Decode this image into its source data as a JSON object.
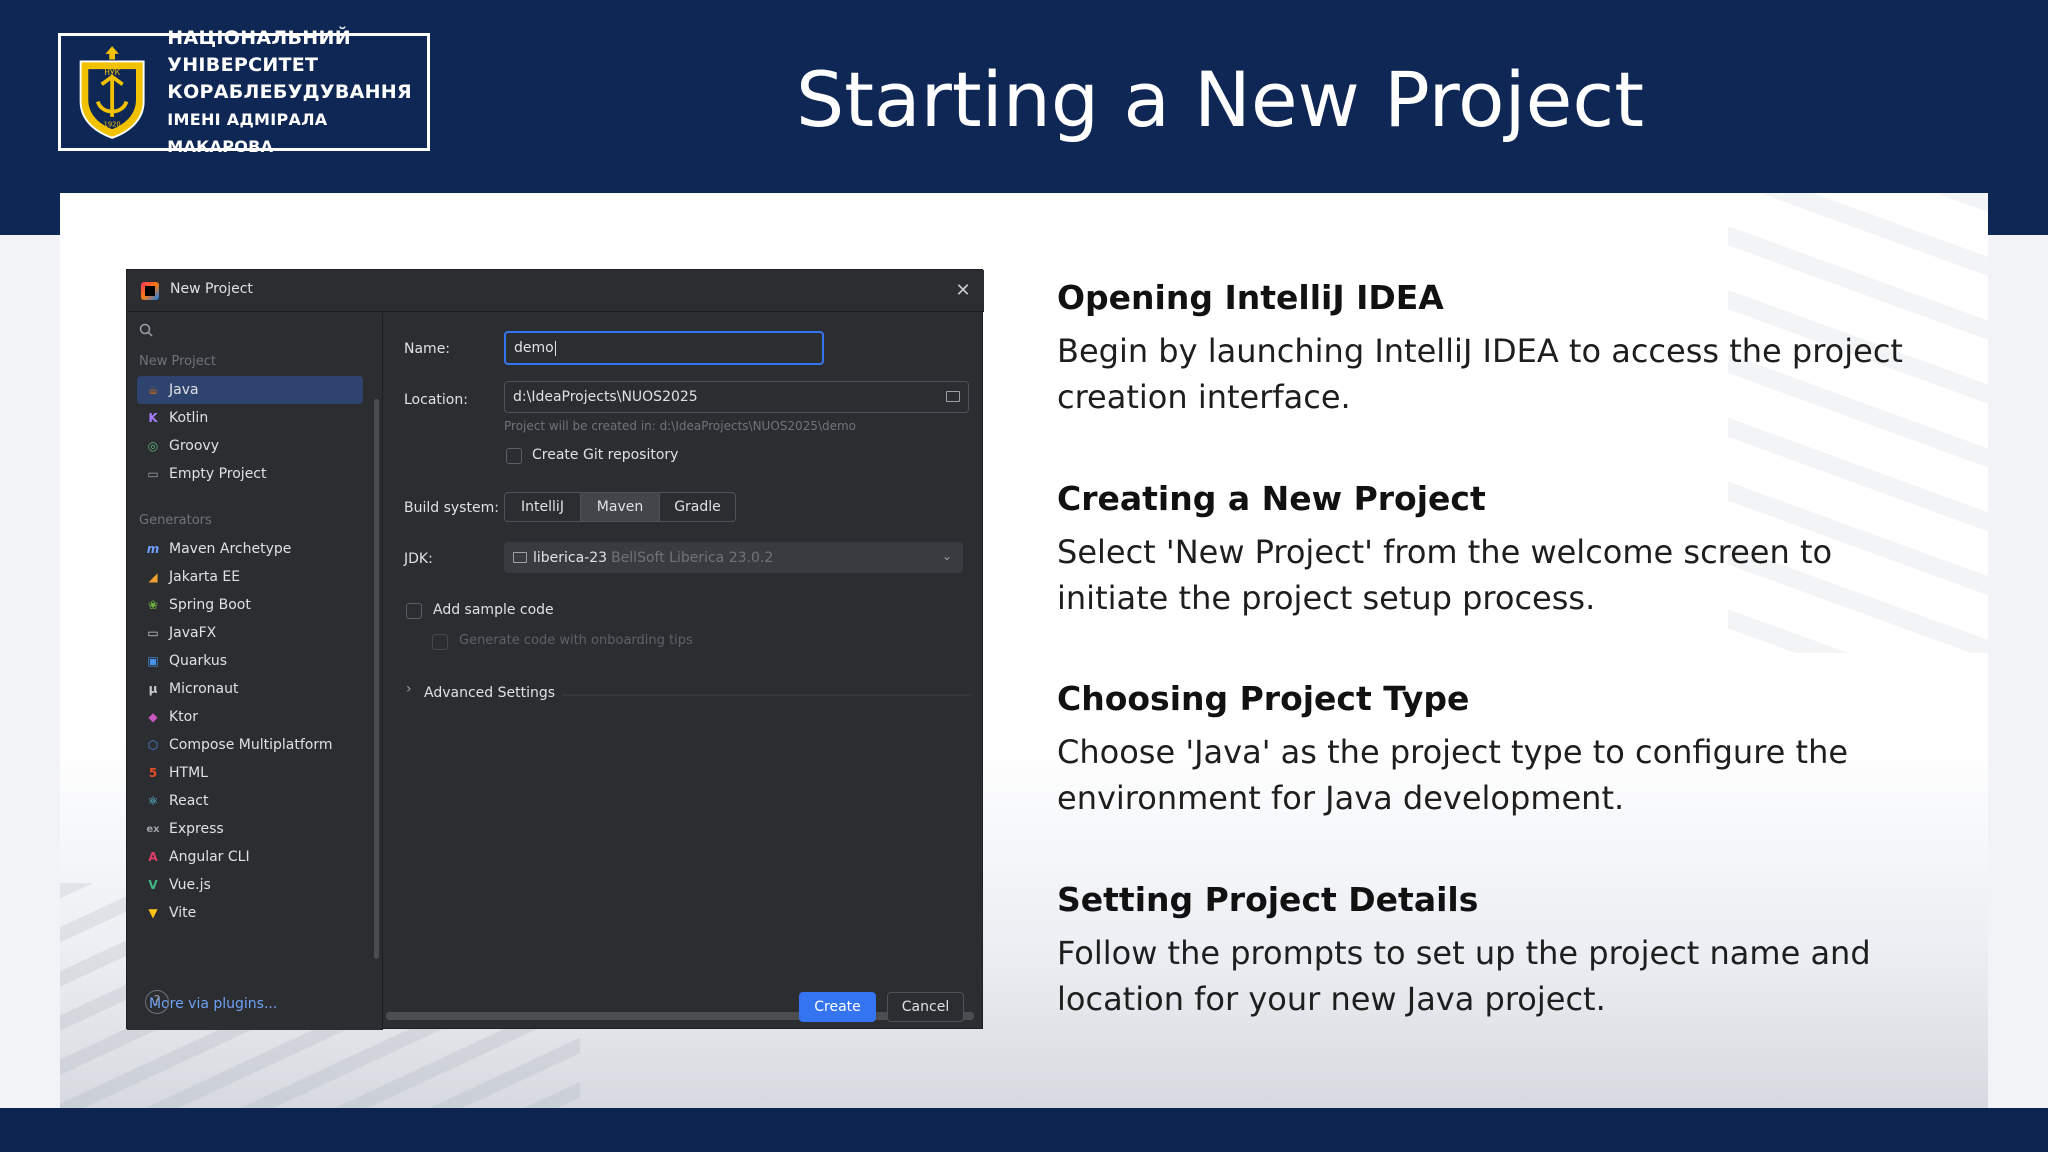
{
  "slide": {
    "title": "Starting a New Project",
    "logo": {
      "lines": [
        "НАЦІОНАЛЬНИЙ",
        "УНІВЕРСИТЕТ",
        "КОРАБЛЕБУДУВАННЯ",
        "ІМЕНІ АДМІРАЛА МАКАРОВА"
      ],
      "emblem_text": "НУК",
      "emblem_year": "1920"
    },
    "colors": {
      "navy": "#0f2755",
      "white": "#ffffff"
    }
  },
  "dialog": {
    "title": "New Project",
    "sidebar": {
      "section_new": "New Project",
      "new_items": [
        {
          "label": "Java",
          "icon": "java-icon",
          "selected": true
        },
        {
          "label": "Kotlin",
          "icon": "kotlin-icon"
        },
        {
          "label": "Groovy",
          "icon": "groovy-icon"
        },
        {
          "label": "Empty Project",
          "icon": "empty-project-icon"
        }
      ],
      "section_generators": "Generators",
      "generator_items": [
        {
          "label": "Maven Archetype",
          "icon": "maven-icon"
        },
        {
          "label": "Jakarta EE",
          "icon": "jakarta-icon"
        },
        {
          "label": "Spring Boot",
          "icon": "spring-icon"
        },
        {
          "label": "JavaFX",
          "icon": "javafx-icon"
        },
        {
          "label": "Quarkus",
          "icon": "quarkus-icon"
        },
        {
          "label": "Micronaut",
          "icon": "micronaut-icon"
        },
        {
          "label": "Ktor",
          "icon": "ktor-icon"
        },
        {
          "label": "Compose Multiplatform",
          "icon": "compose-icon"
        },
        {
          "label": "HTML",
          "icon": "html-icon"
        },
        {
          "label": "React",
          "icon": "react-icon"
        },
        {
          "label": "Express",
          "icon": "express-icon"
        },
        {
          "label": "Angular CLI",
          "icon": "angular-icon"
        },
        {
          "label": "Vue.js",
          "icon": "vue-icon"
        },
        {
          "label": "Vite",
          "icon": "vite-icon"
        }
      ],
      "more_plugins": "More via plugins..."
    },
    "form": {
      "name_label": "Name:",
      "name_value": "demo",
      "location_label": "Location:",
      "location_value": "d:\\IdeaProjects\\NUOS2025",
      "location_hint": "Project will be created in: d:\\IdeaProjects\\NUOS2025\\demo",
      "git_label": "Create Git repository",
      "build_label": "Build system:",
      "build_options": [
        "IntelliJ",
        "Maven",
        "Gradle"
      ],
      "build_selected": "Maven",
      "jdk_label": "JDK:",
      "jdk_value": "liberica-23",
      "jdk_detail": "BellSoft Liberica 23.0.2",
      "sample_label": "Add sample code",
      "onboarding_label": "Generate code with onboarding tips",
      "advanced_label": "Advanced Settings"
    },
    "buttons": {
      "help": "?",
      "create": "Create",
      "cancel": "Cancel"
    },
    "colors": {
      "bg": "#2b2d30",
      "accent": "#3574f0",
      "selected": "#2e436e"
    }
  },
  "content": {
    "items": [
      {
        "heading": "Opening IntelliJ IDEA",
        "body": "Begin by launching IntelliJ IDEA to access the project creation interface."
      },
      {
        "heading": "Creating a New Project",
        "body": "Select 'New Project' from the welcome screen to initiate the project setup process."
      },
      {
        "heading": "Choosing Project Type",
        "body": "Choose 'Java' as the project type to configure the environment for Java development."
      },
      {
        "heading": "Setting Project Details",
        "body": "Follow the prompts to set up the project name and location for your new Java project."
      }
    ]
  }
}
